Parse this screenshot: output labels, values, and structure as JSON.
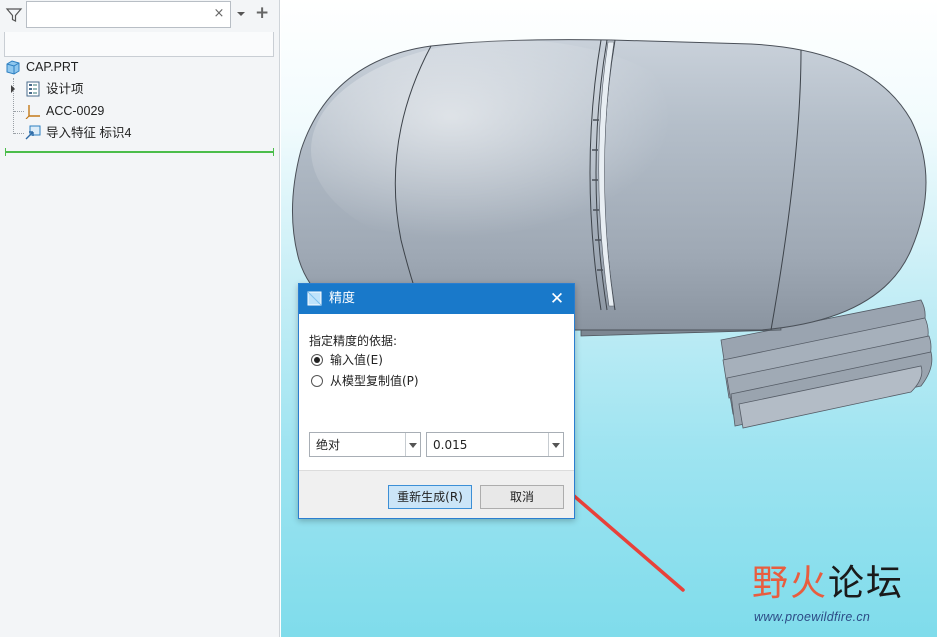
{
  "tree_panel": {
    "search": {
      "value": "",
      "clear_glyph": "×"
    },
    "add_glyph": "+",
    "items": [
      {
        "label": "CAP.PRT",
        "icon": "part-icon"
      },
      {
        "label": "设计项",
        "icon": "design-items-icon",
        "expandable": true
      },
      {
        "label": "ACC-0029",
        "icon": "coordinate-system-icon"
      },
      {
        "label": "导入特征 标识4",
        "icon": "import-feature-icon"
      }
    ]
  },
  "dialog": {
    "title": "精度",
    "close_glyph": "✕",
    "prompt": "指定精度的依据:",
    "radio_options": [
      {
        "label": "输入值(E)",
        "checked": true
      },
      {
        "label": "从模型复制值(P)",
        "checked": false
      }
    ],
    "mode_select": {
      "value": "绝对"
    },
    "value_select": {
      "value": "0.015"
    },
    "buttons": {
      "regenerate": "重新生成(R)",
      "cancel": "取消"
    }
  },
  "watermark": {
    "logo_part1": "野",
    "logo_part2": "火",
    "logo_part3": "论坛",
    "url": "www.proewildfire.cn"
  },
  "colors": {
    "dialog_titlebar": "#1979ca",
    "arrow": "#e8413a",
    "insert_line": "#4bbd4b",
    "model_gray": "#a9b3bf"
  }
}
